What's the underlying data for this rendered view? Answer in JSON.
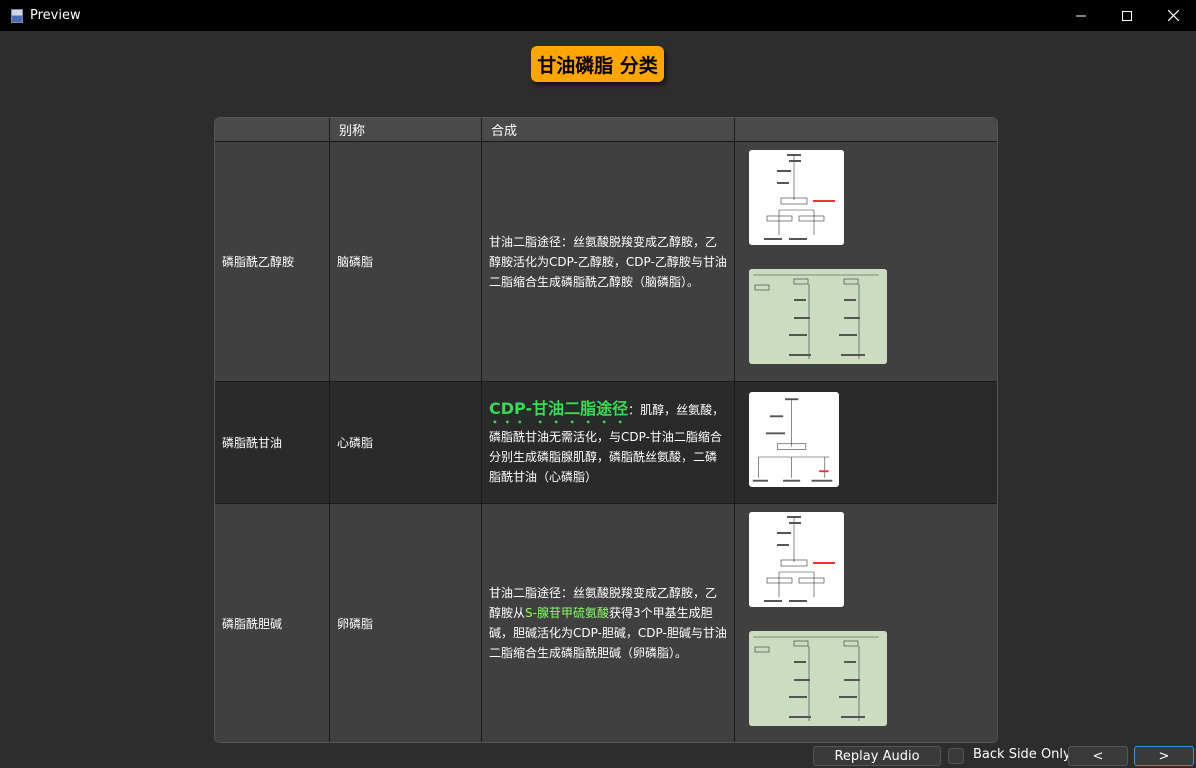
{
  "window": {
    "title": "Preview",
    "controls": [
      "minimize-icon",
      "maximize-icon",
      "close-icon"
    ]
  },
  "card": {
    "heading": "甘油磷脂 分类",
    "table": {
      "headers": [
        "",
        "别称",
        "合成",
        ""
      ],
      "rows": [
        {
          "name": "磷脂酰乙醇胺",
          "alias": "脑磷脂",
          "synthesis": "甘油二脂途径：丝氨酸脱羧变成乙醇胺，乙醇胺活化为CDP-乙醇胺，CDP-乙醇胺与甘油二脂缩合生成磷脂酰乙醇胺（脑磷脂）。",
          "images": [
            "pathway-diagram",
            "pathway-diagram-green"
          ]
        },
        {
          "name": "磷脂酰甘油",
          "alias": "心磷脂",
          "synthesis_highlight": "CDP-甘油二脂途径",
          "synthesis_rest": "：肌醇，丝氨酸，磷脂酰甘油无需活化，与CDP-甘油二脂缩合分别生成磷脂腺肌醇，磷脂酰丝氨酸，二磷脂酰甘油（心磷脂）",
          "images": [
            "pathway-diagram"
          ]
        },
        {
          "name": "磷脂酰胆碱",
          "alias": "卵磷脂",
          "synthesis_pre": "甘油二脂途径：丝氨酸脱羧变成乙醇胺，乙醇胺从",
          "synthesis_highlight": "S-腺苷甲硫氨酸",
          "synthesis_post": "获得3个甲基生成胆碱，胆碱活化为CDP-胆碱，CDP-胆碱与甘油二脂缩合生成磷脂酰胆碱（卵磷脂）。",
          "images": [
            "pathway-diagram",
            "pathway-diagram-green"
          ]
        }
      ]
    }
  },
  "footer": {
    "replay_label": "Replay Audio",
    "back_side_label": "Back Side Only",
    "prev_label": "<",
    "next_label": ">"
  },
  "colors": {
    "heading_bg": "#ffa500",
    "highlight_green": "#33dd55",
    "highlight_lime": "#88ff66",
    "accent_border": "#4a8fd6"
  }
}
